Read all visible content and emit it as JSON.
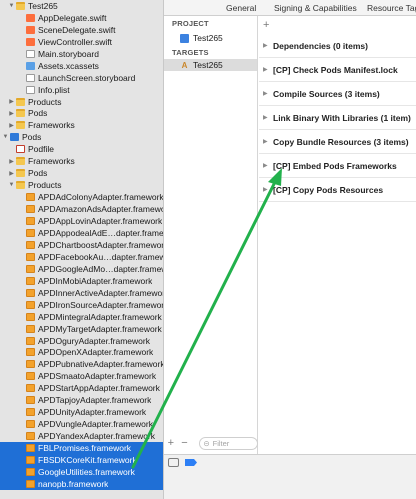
{
  "tabs": [
    "General",
    "Signing & Capabilities",
    "Resource Tags"
  ],
  "navigator": {
    "rows": [
      {
        "label": "Test265",
        "depth": 0,
        "disclosure": "open",
        "icon": "folder",
        "selected": false
      },
      {
        "label": "AppDelegate.swift",
        "depth": 1,
        "disclosure": "none",
        "icon": "swift",
        "selected": false
      },
      {
        "label": "SceneDelegate.swift",
        "depth": 1,
        "disclosure": "none",
        "icon": "swift",
        "selected": false
      },
      {
        "label": "ViewController.swift",
        "depth": 1,
        "disclosure": "none",
        "icon": "swift",
        "selected": false
      },
      {
        "label": "Main.storyboard",
        "depth": 1,
        "disclosure": "none",
        "icon": "storyboard",
        "selected": false
      },
      {
        "label": "Assets.xcassets",
        "depth": 1,
        "disclosure": "none",
        "icon": "assets",
        "selected": false
      },
      {
        "label": "LaunchScreen.storyboard",
        "depth": 1,
        "disclosure": "none",
        "icon": "storyboard",
        "selected": false
      },
      {
        "label": "Info.plist",
        "depth": 1,
        "disclosure": "none",
        "icon": "plist",
        "selected": false
      },
      {
        "label": "Products",
        "depth": 0,
        "disclosure": "closed",
        "icon": "folder",
        "selected": false
      },
      {
        "label": "Pods",
        "depth": 0,
        "disclosure": "closed",
        "icon": "folder",
        "selected": false
      },
      {
        "label": "Frameworks",
        "depth": 0,
        "disclosure": "closed",
        "icon": "folder",
        "selected": false
      },
      {
        "label": "Pods",
        "depth": -1,
        "disclosure": "open",
        "icon": "project",
        "selected": false
      },
      {
        "label": "Podfile",
        "depth": 0,
        "disclosure": "none",
        "icon": "podfile",
        "selected": false
      },
      {
        "label": "Frameworks",
        "depth": 0,
        "disclosure": "closed",
        "icon": "folder",
        "selected": false
      },
      {
        "label": "Pods",
        "depth": 0,
        "disclosure": "closed",
        "icon": "folder",
        "selected": false
      },
      {
        "label": "Products",
        "depth": 0,
        "disclosure": "open",
        "icon": "folder",
        "selected": false
      },
      {
        "label": "APDAdColonyAdapter.framework",
        "depth": 1,
        "disclosure": "none",
        "icon": "framework",
        "selected": false
      },
      {
        "label": "APDAmazonAdsAdapter.framework",
        "depth": 1,
        "disclosure": "none",
        "icon": "framework",
        "selected": false
      },
      {
        "label": "APDAppLovinAdapter.framework",
        "depth": 1,
        "disclosure": "none",
        "icon": "framework",
        "selected": false
      },
      {
        "label": "APDAppodealAdE…dapter.framework",
        "depth": 1,
        "disclosure": "none",
        "icon": "framework",
        "selected": false
      },
      {
        "label": "APDChartboostAdapter.framework",
        "depth": 1,
        "disclosure": "none",
        "icon": "framework",
        "selected": false
      },
      {
        "label": "APDFacebookAu…dapter.framework",
        "depth": 1,
        "disclosure": "none",
        "icon": "framework",
        "selected": false
      },
      {
        "label": "APDGoogleAdMo…dapter.framework",
        "depth": 1,
        "disclosure": "none",
        "icon": "framework",
        "selected": false
      },
      {
        "label": "APDInMobiAdapter.framework",
        "depth": 1,
        "disclosure": "none",
        "icon": "framework",
        "selected": false
      },
      {
        "label": "APDInnerActiveAdapter.framework",
        "depth": 1,
        "disclosure": "none",
        "icon": "framework",
        "selected": false
      },
      {
        "label": "APDIronSourceAdapter.framework",
        "depth": 1,
        "disclosure": "none",
        "icon": "framework",
        "selected": false
      },
      {
        "label": "APDMintegralAdapter.framework",
        "depth": 1,
        "disclosure": "none",
        "icon": "framework",
        "selected": false
      },
      {
        "label": "APDMyTargetAdapter.framework",
        "depth": 1,
        "disclosure": "none",
        "icon": "framework",
        "selected": false
      },
      {
        "label": "APDOguryAdapter.framework",
        "depth": 1,
        "disclosure": "none",
        "icon": "framework",
        "selected": false
      },
      {
        "label": "APDOpenXAdapter.framework",
        "depth": 1,
        "disclosure": "none",
        "icon": "framework",
        "selected": false
      },
      {
        "label": "APDPubnativeAdapter.framework",
        "depth": 1,
        "disclosure": "none",
        "icon": "framework",
        "selected": false
      },
      {
        "label": "APDSmaatoAdapter.framework",
        "depth": 1,
        "disclosure": "none",
        "icon": "framework",
        "selected": false
      },
      {
        "label": "APDStartAppAdapter.framework",
        "depth": 1,
        "disclosure": "none",
        "icon": "framework",
        "selected": false
      },
      {
        "label": "APDTapjoyAdapter.framework",
        "depth": 1,
        "disclosure": "none",
        "icon": "framework",
        "selected": false
      },
      {
        "label": "APDUnityAdapter.framework",
        "depth": 1,
        "disclosure": "none",
        "icon": "framework",
        "selected": false
      },
      {
        "label": "APDVungleAdapter.framework",
        "depth": 1,
        "disclosure": "none",
        "icon": "framework",
        "selected": false
      },
      {
        "label": "APDYandexAdapter.framework",
        "depth": 1,
        "disclosure": "none",
        "icon": "framework",
        "selected": false
      },
      {
        "label": "FBLPromises.framework",
        "depth": 1,
        "disclosure": "none",
        "icon": "framework",
        "selected": true
      },
      {
        "label": "FBSDKCoreKit.framework",
        "depth": 1,
        "disclosure": "none",
        "icon": "framework",
        "selected": true
      },
      {
        "label": "GoogleUtilities.framework",
        "depth": 1,
        "disclosure": "none",
        "icon": "framework",
        "selected": true
      },
      {
        "label": "nanopb.framework",
        "depth": 1,
        "disclosure": "none",
        "icon": "framework",
        "selected": true
      }
    ]
  },
  "project_column": {
    "project_header": "PROJECT",
    "project_item": "Test265",
    "targets_header": "TARGETS",
    "target_item": "Test265",
    "filter_placeholder": "Filter",
    "add_symbol": "+",
    "remove_symbol": "−"
  },
  "build_phases": {
    "add_symbol": "+",
    "items": [
      "Dependencies (0 items)",
      "[CP] Check Pods Manifest.lock",
      "Compile Sources (3 items)",
      "Link Binary With Libraries (1 item)",
      "Copy Bundle Resources (3 items)",
      "[CP] Embed Pods Frameworks",
      "[CP] Copy Pods Resources"
    ]
  },
  "colors": {
    "selection": "#1f6fd6",
    "annotation_arrow": "#22b14c",
    "framework_icon": "#f3a22c",
    "folder_icon": "#f4c74f"
  },
  "icons": {
    "disclosure_open": "▼",
    "disclosure_closed": "▶",
    "target": "A",
    "console": "▭",
    "filter": "⊝"
  }
}
